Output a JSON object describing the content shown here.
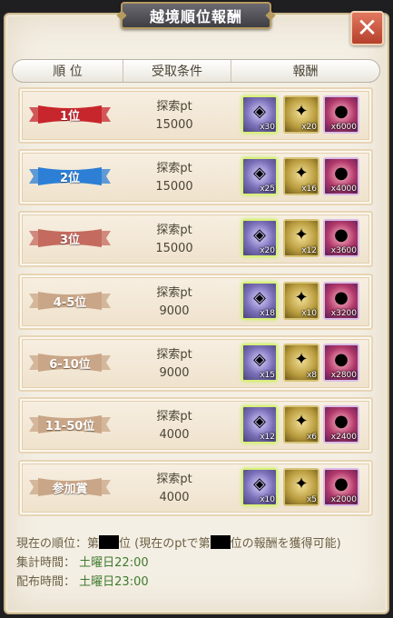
{
  "window": {
    "title": "越境順位報酬",
    "close_glyph": "✕"
  },
  "table_header": {
    "rank": "順 位",
    "condition": "受取条件",
    "reward": "報酬"
  },
  "rows": [
    {
      "rank": "1位",
      "cond_label": "探索pt",
      "cond_value": "15000",
      "ribbon": "#c7262c",
      "q1": "x30",
      "q2": "x20",
      "q3": "x6000"
    },
    {
      "rank": "2位",
      "cond_label": "探索pt",
      "cond_value": "15000",
      "ribbon": "#2c7fd4",
      "q1": "x25",
      "q2": "x16",
      "q3": "x4000"
    },
    {
      "rank": "3位",
      "cond_label": "探索pt",
      "cond_value": "15000",
      "ribbon": "#c46a5e",
      "q1": "x20",
      "q2": "x12",
      "q3": "x3600"
    },
    {
      "rank": "4-5位",
      "cond_label": "探索pt",
      "cond_value": "9000",
      "ribbon": "#c9a687",
      "q1": "x18",
      "q2": "x10",
      "q3": "x3200"
    },
    {
      "rank": "6-10位",
      "cond_label": "探索pt",
      "cond_value": "9000",
      "ribbon": "#c9a687",
      "q1": "x15",
      "q2": "x8",
      "q3": "x2800"
    },
    {
      "rank": "11-50位",
      "cond_label": "探索pt",
      "cond_value": "4000",
      "ribbon": "#c9a687",
      "q1": "x12",
      "q2": "x6",
      "q3": "x2400"
    },
    {
      "rank": "参加賞",
      "cond_label": "探索pt",
      "cond_value": "4000",
      "ribbon": "#c9a687",
      "q1": "x10",
      "q2": "x5",
      "q3": "x2000"
    }
  ],
  "reward_icons": {
    "r1": "jewel-chest-icon",
    "r2": "scroll-icon",
    "r3": "red-gem-icon"
  },
  "footer": {
    "current_rank_label": "現在の順位：",
    "current_rank_prefix": "第",
    "current_rank_suffix": "位 (現在のptで第",
    "current_rank_tail": "位の報酬を獲得可能)",
    "tally_label": "集計時間：",
    "tally_value": "土曜日22:00",
    "distribution_label": "配布時間：",
    "distribution_value": "土曜日23:00"
  }
}
